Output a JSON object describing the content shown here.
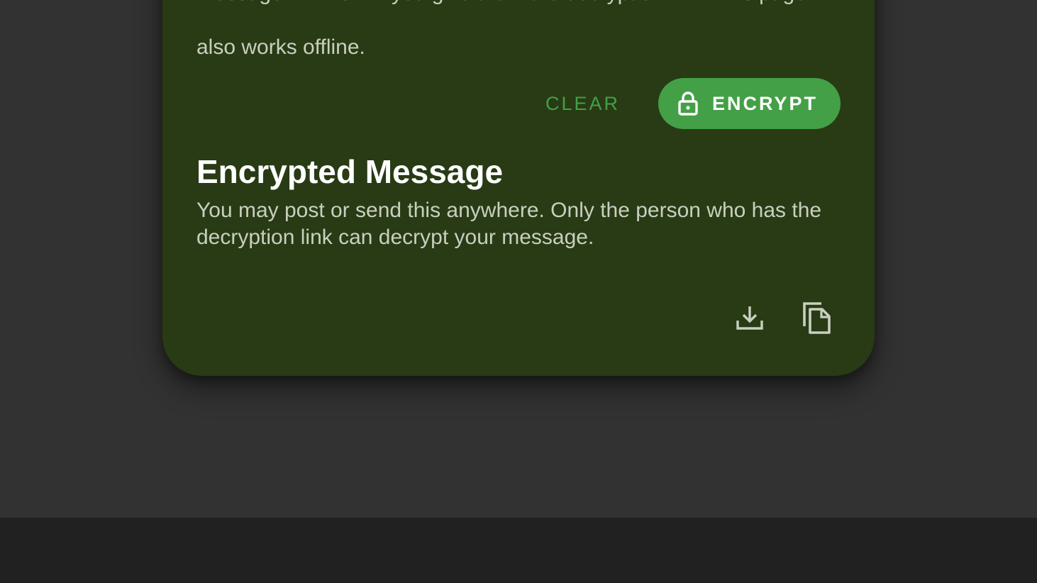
{
  "card": {
    "intro_line_1": "message will work if you give them the decryption link. This page",
    "intro_line_2": "also works offline.",
    "clear_label": "CLEAR",
    "encrypt_label": "ENCRYPT",
    "encrypt_icon": "lock-icon",
    "encrypted_title": "Encrypted Message",
    "encrypted_desc": "You may post or send this anywhere. Only the person who has the decryption link can decrypt your message.",
    "download_icon": "download-icon",
    "copy_icon": "copy-icon"
  },
  "colors": {
    "page_bg": "#323232",
    "footer_bg": "#212121",
    "card_bg": "#283b14",
    "accent": "#43a047",
    "body_text": "#c9cfc0",
    "title_text": "#ffffff"
  }
}
